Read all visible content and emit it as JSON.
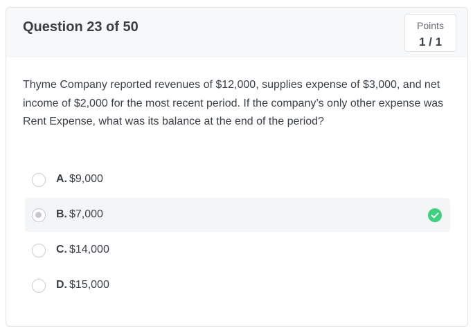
{
  "header": {
    "question_label": "Question 23 of 50",
    "points_label": "Points",
    "points_value": "1 / 1"
  },
  "question": {
    "text": "Thyme Company reported revenues of $12,000, supplies expense of $3,000, and net income of $2,000 for the most recent period. If the company’s only other expense was Rent Expense, what was its balance at the end of the period?"
  },
  "options": [
    {
      "letter": "A.",
      "value": "$9,000",
      "selected": false,
      "correct": false
    },
    {
      "letter": "B.",
      "value": "$7,000",
      "selected": true,
      "correct": true
    },
    {
      "letter": "C.",
      "value": "$14,000",
      "selected": false,
      "correct": false
    },
    {
      "letter": "D.",
      "value": "$15,000",
      "selected": false,
      "correct": false
    }
  ],
  "colors": {
    "correct": "#3ecf7f",
    "selected_background": "#f4f5f6",
    "header_background": "#f7f8f9"
  },
  "icons": {
    "correct_indicator": "check-circle-icon"
  }
}
